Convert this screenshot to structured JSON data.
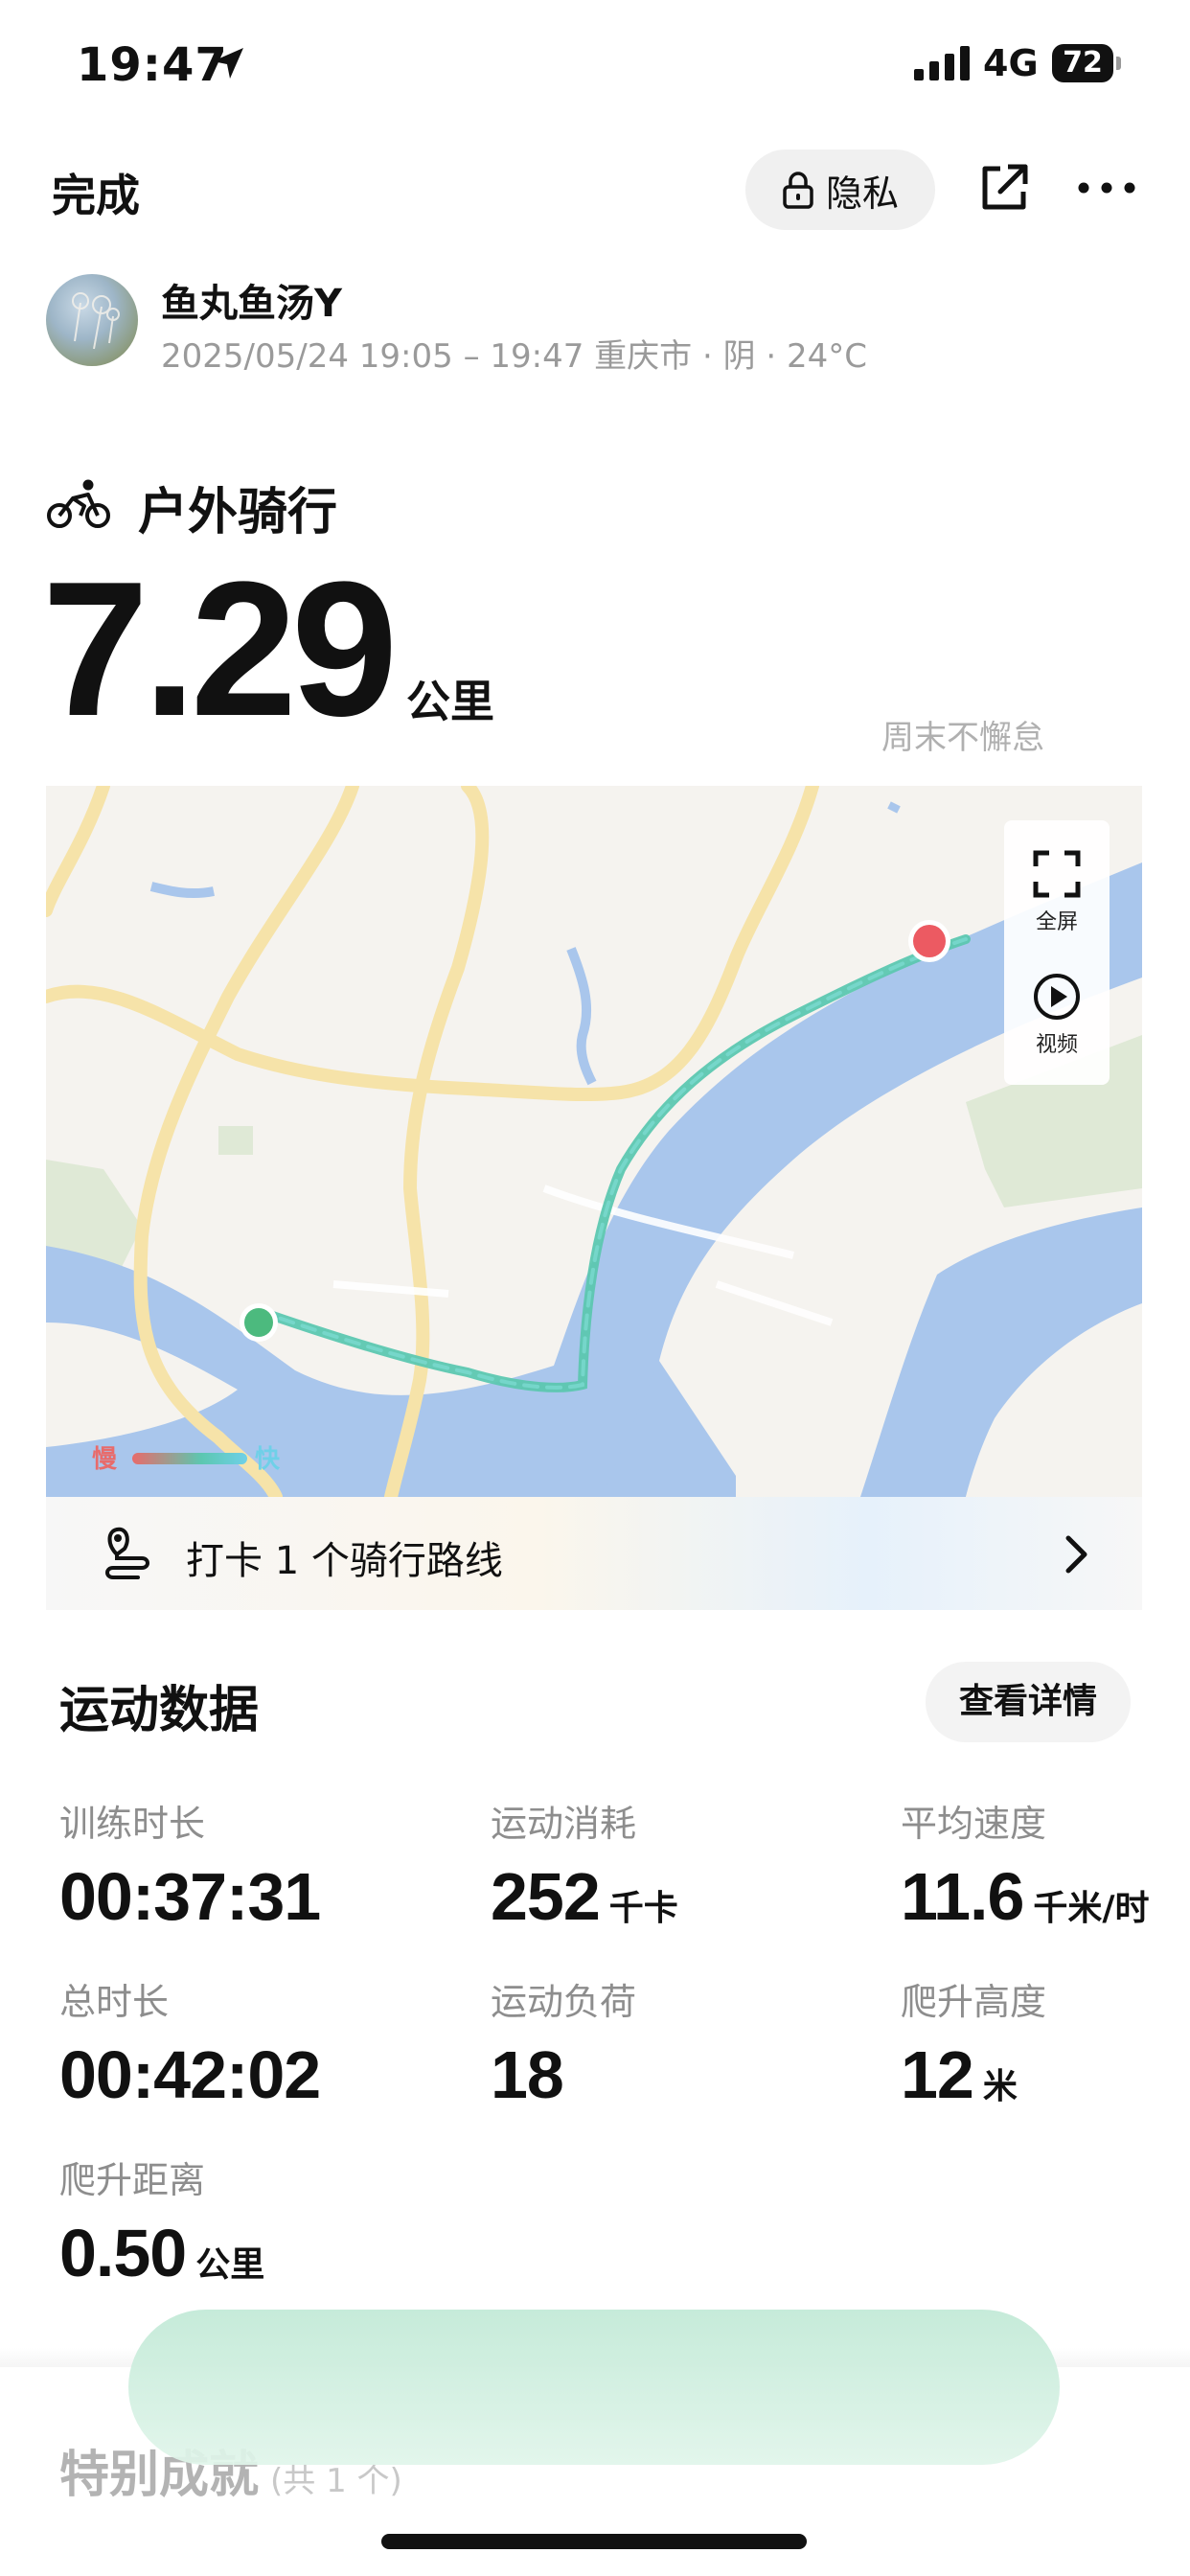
{
  "status_bar": {
    "time": "19:47",
    "network": "4G",
    "battery": "72"
  },
  "nav": {
    "done_label": "完成",
    "privacy_label": "隐私"
  },
  "user": {
    "name": "鱼丸鱼汤Y",
    "meta": "2025/05/24 19:05 – 19:47 重庆市 · 阴 · 24°C"
  },
  "activity": {
    "type": "户外骑行",
    "distance": "7.29",
    "distance_unit": "公里",
    "slogan": "周末不懈怠"
  },
  "map": {
    "fullscreen_label": "全屏",
    "video_label": "视频",
    "speed_slow": "慢",
    "speed_fast": "快",
    "start_color": "#4cba7e",
    "end_color": "#ec5a62",
    "route_color": "#5cc7b0"
  },
  "checkin": {
    "text": "打卡 1 个骑行路线"
  },
  "stats_section": {
    "title": "运动数据",
    "detail_button": "查看详情",
    "items": [
      {
        "label": "训练时长",
        "value": "00:37:31",
        "unit": ""
      },
      {
        "label": "运动消耗",
        "value": "252",
        "unit": "千卡"
      },
      {
        "label": "平均速度",
        "value": "11.6",
        "unit": "千米/时"
      },
      {
        "label": "总时长",
        "value": "00:42:02",
        "unit": ""
      },
      {
        "label": "运动负荷",
        "value": "18",
        "unit": ""
      },
      {
        "label": "爬升高度",
        "value": "12",
        "unit": "米"
      },
      {
        "label": "爬升距离",
        "value": "0.50",
        "unit": "公里"
      }
    ]
  },
  "achievements": {
    "title": "特别成就",
    "count": "(共 1 个)"
  }
}
